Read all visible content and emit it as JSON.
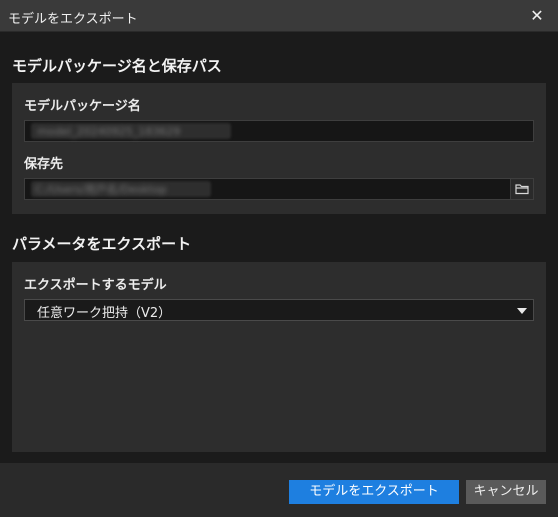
{
  "window": {
    "title": "モデルをエクスポート",
    "close_glyph": "✕"
  },
  "section_package": {
    "heading": "モデルパッケージ名と保存パス",
    "package_name_label": "モデルパッケージ名",
    "package_name_value": "model_20240925_183629",
    "save_to_label": "保存先",
    "save_to_value": "C:/Users/用戸名/Desktop",
    "browse_icon": "folder-icon"
  },
  "section_params": {
    "heading": "パラメータをエクスポート",
    "model_label": "エクスポートするモデル",
    "model_selected": "任意ワーク把持（V2）"
  },
  "footer": {
    "export_label": "モデルをエクスポート",
    "cancel_label": "キャンセル"
  },
  "colors": {
    "accent": "#1e7fe0",
    "background": "#1b1b1b",
    "panel": "#2d2d2d"
  }
}
